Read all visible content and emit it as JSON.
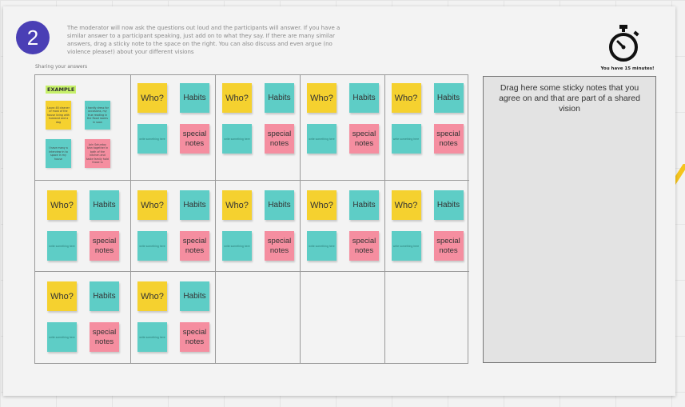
{
  "step": {
    "number": "2"
  },
  "instructions": "The moderator will now ask the questions out loud and the participants will answer. If you have a similar answer to a participant speaking, just add on to what they say. If there are many similar answers, drag a sticky note to the space on the right. You can also discuss and even argue (no violence please!) about your different visions",
  "grid_title": "Sharing your answers",
  "timer": {
    "icon": "stopwatch-icon",
    "text": "You have 15 minutes!"
  },
  "example": {
    "label": "EXAMPLE",
    "notes": [
      {
        "text": "Laura 48 cleaner of most of the house living with husband and a dog"
      },
      {
        "text": "I hardly dress for occasions, my true reading in the flood rooms in soon"
      },
      {
        "text": "I have many a interview in to space in my house"
      },
      {
        "text": "Join Saturday Ivan together in both of the kitchen and taste family hold those lu"
      }
    ]
  },
  "note_labels": {
    "who": "Who?",
    "habits": "Habits",
    "special": "special notes",
    "blank": "write something here"
  },
  "participants": 11,
  "dropzone": {
    "text": "Drag here some sticky notes that you agree on and that are part of a shared vision"
  },
  "colors": {
    "yellow": "#f5d12f",
    "teal": "#5ecdc6",
    "pink": "#f58ea0",
    "badge": "#4a3fb5"
  }
}
